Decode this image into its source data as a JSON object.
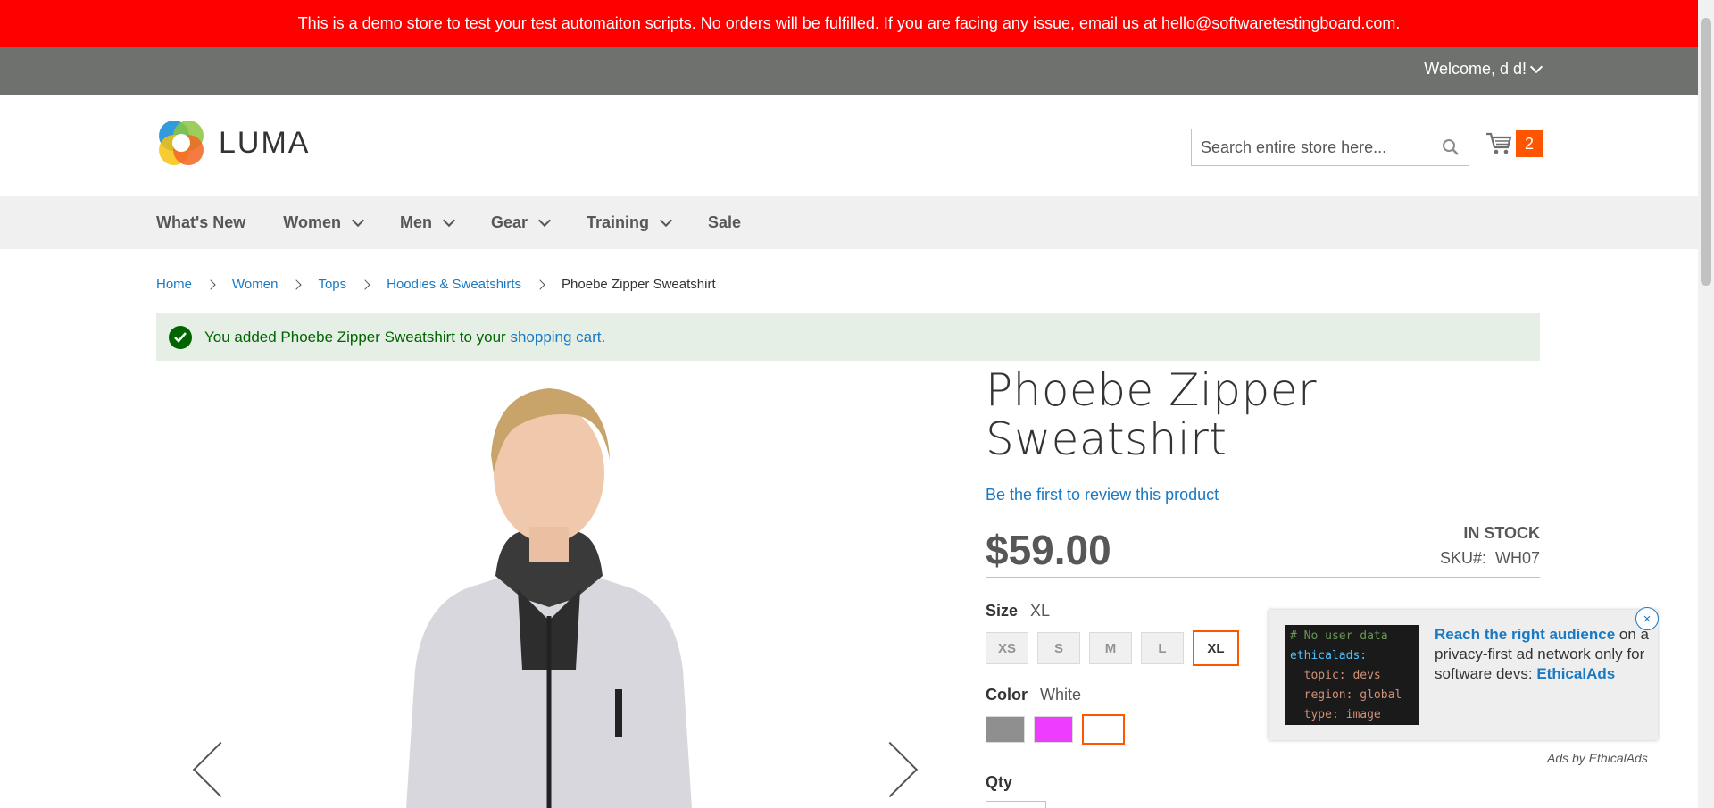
{
  "banner": {
    "text": "This is a demo store to test your test automaiton scripts. No orders will be fulfilled. If you are facing any issue, email us at hello@softwaretestingboard.com."
  },
  "header": {
    "welcome": "Welcome, d d!",
    "logo_text": "LUMA",
    "search_placeholder": "Search entire store here...",
    "cart_count": "2"
  },
  "nav": {
    "items": [
      {
        "label": "What's New",
        "has_dropdown": false
      },
      {
        "label": "Women",
        "has_dropdown": true
      },
      {
        "label": "Men",
        "has_dropdown": true
      },
      {
        "label": "Gear",
        "has_dropdown": true
      },
      {
        "label": "Training",
        "has_dropdown": true
      },
      {
        "label": "Sale",
        "has_dropdown": false
      }
    ]
  },
  "breadcrumb": {
    "links": [
      "Home",
      "Women",
      "Tops",
      "Hoodies & Sweatshirts"
    ],
    "current": "Phoebe Zipper Sweatshirt"
  },
  "message": {
    "text": "You added Phoebe Zipper Sweatshirt to your ",
    "link": "shopping cart",
    "suffix": "."
  },
  "product": {
    "title": "Phoebe Zipper Sweatshirt",
    "review_link": "Be the first to review this product",
    "price": "$59.00",
    "stock": "IN STOCK",
    "sku_label": "SKU#:",
    "sku": "WH07",
    "size_label": "Size",
    "size_selected": "XL",
    "sizes": [
      "XS",
      "S",
      "M",
      "L",
      "XL"
    ],
    "color_label": "Color",
    "color_selected": "White",
    "colors": [
      "#8f8f8f",
      "#ef3dff",
      "#ffffff"
    ],
    "qty_label": "Qty"
  },
  "ad": {
    "code_lines": [
      "# No user data",
      "ethicalads:",
      "  topic: devs",
      "  region: global",
      "  type: image"
    ],
    "headline": "Reach the right audience",
    "body": " on a privacy-first ad network only for software devs: ",
    "brand": "EthicalAds",
    "close": "×",
    "by": "Ads by EthicalAds"
  },
  "colors": {
    "accent": "#ff5501",
    "link": "#1979c3",
    "banner": "#ff0000",
    "panel": "#6e716e"
  }
}
